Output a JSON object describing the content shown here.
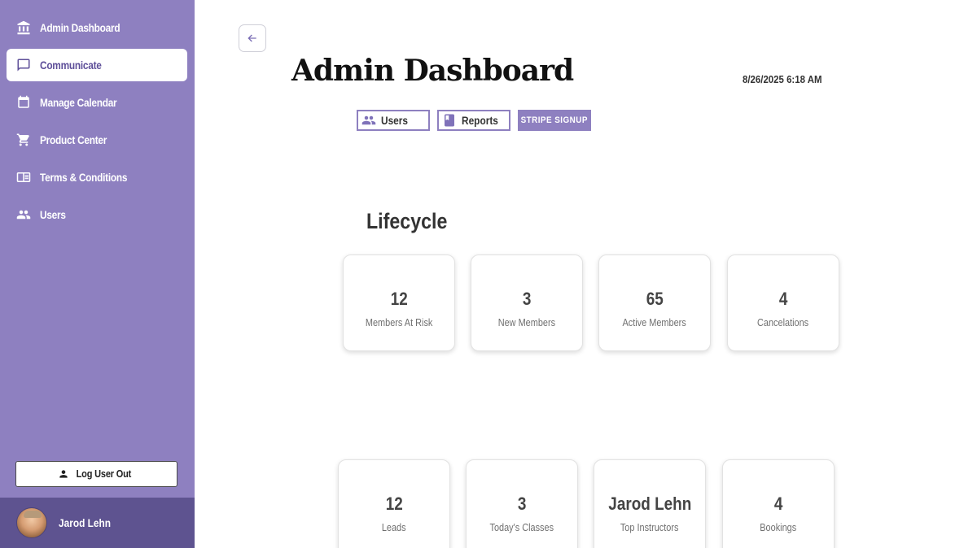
{
  "sidebar": {
    "items": [
      {
        "label": "Admin Dashboard",
        "icon": "bank-icon"
      },
      {
        "label": "Communicate",
        "icon": "chat-icon",
        "active": true
      },
      {
        "label": "Manage Calendar",
        "icon": "calendar-icon"
      },
      {
        "label": "Product Center",
        "icon": "cart-icon"
      },
      {
        "label": "Terms & Conditions",
        "icon": "document-icon"
      },
      {
        "label": "Users",
        "icon": "group-icon"
      }
    ],
    "logout_label": "Log User Out",
    "user_name": "Jarod Lehn"
  },
  "header": {
    "title": "Admin Dashboard",
    "datetime": "8/26/2025 6:18 AM"
  },
  "tabs": {
    "users": "Users",
    "reports": "Reports",
    "stripe": "STRIPE SIGNUP"
  },
  "lifecycle": {
    "title": "Lifecycle",
    "cards": [
      {
        "value": "12",
        "label": "Members At Risk"
      },
      {
        "value": "3",
        "label": "New Members"
      },
      {
        "value": "65",
        "label": "Active Members"
      },
      {
        "value": "4",
        "label": "Cancelations"
      }
    ]
  },
  "stats": {
    "cards": [
      {
        "value": "12",
        "label": "Leads"
      },
      {
        "value": "3",
        "label": "Today's Classes"
      },
      {
        "value": "Jarod Lehn",
        "label": "Top Instructors"
      },
      {
        "value": "4",
        "label": "Bookings"
      }
    ]
  },
  "colors": {
    "sidebar": "#8e80c0",
    "sidebar_active_text": "#5e4f99",
    "userbar": "#5e5390"
  }
}
